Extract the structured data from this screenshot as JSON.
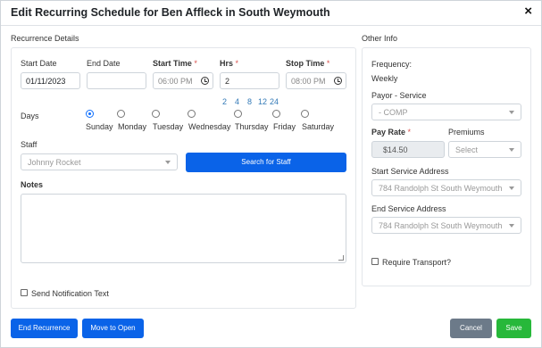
{
  "modal": {
    "title": "Edit Recurring Schedule for Ben Affleck in South Weymouth",
    "close_glyph": "×"
  },
  "recurrence": {
    "section_label": "Recurrence Details",
    "start_date_label": "Start Date",
    "start_date_value": "01/11/2023",
    "end_date_label": "End Date",
    "end_date_value": "",
    "start_time_label": "Start Time",
    "start_time_value": "06:00 PM",
    "hrs_label": "Hrs",
    "hrs_value": "2",
    "stop_time_label": "Stop Time",
    "stop_time_value": "08:00 PM",
    "required_mark": "*",
    "hrs_presets": [
      "2",
      "4",
      "8",
      "12",
      "24"
    ],
    "days_label": "Days",
    "days": [
      {
        "label": "Sunday",
        "checked": true
      },
      {
        "label": "Monday",
        "checked": false
      },
      {
        "label": "Tuesday",
        "checked": false
      },
      {
        "label": "Wednesday",
        "checked": false
      },
      {
        "label": "Thursday",
        "checked": false
      },
      {
        "label": "Friday",
        "checked": false
      },
      {
        "label": "Saturday",
        "checked": false
      }
    ],
    "staff_label": "Staff",
    "staff_placeholder": "Johnny Rocket",
    "search_staff_button": "Search for Staff",
    "notes_label": "Notes",
    "send_notification_label": "Send Notification Text"
  },
  "other_info": {
    "section_label": "Other Info",
    "frequency_label": "Frequency:",
    "frequency_value": "Weekly",
    "payor_label": "Payor - Service",
    "payor_value": "- COMP",
    "pay_rate_label": "Pay Rate",
    "pay_rate_value": "$14.50",
    "premiums_label": "Premiums",
    "premiums_placeholder": "Select",
    "start_address_label": "Start Service Address",
    "start_address_value": "784 Randolph St South Weymouth",
    "end_address_label": "End Service Address",
    "end_address_value": "784 Randolph St South Weymouth",
    "require_transport_label": "Require Transport?"
  },
  "footer": {
    "end_recurrence": "End Recurrence",
    "move_to_open": "Move to Open",
    "cancel": "Cancel",
    "save": "Save"
  },
  "colors": {
    "primary": "#0a63e8",
    "cancel": "#6c7a89",
    "save": "#27b83a",
    "required": "#d9534f",
    "link": "#337ab7"
  }
}
